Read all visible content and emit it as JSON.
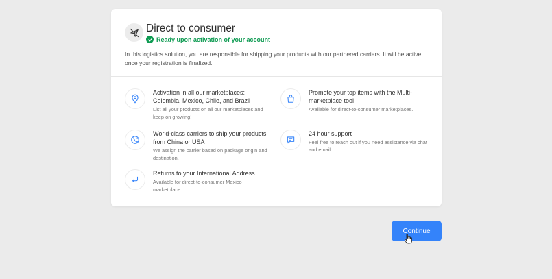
{
  "card": {
    "title": "Direct to consumer",
    "status_text": "Ready upon activation of your account",
    "description": "In this logistics solution, you are responsible for shipping your products with our partnered carriers. It will be active once your registration is finalized."
  },
  "features": [
    {
      "icon": "location-pin-icon",
      "title": "Activation in all our marketplaces: Colombia, Mexico, Chile, and Brazil",
      "subtitle": "List all your products on all our marketplaces and keep on growing!"
    },
    {
      "icon": "shopping-bag-icon",
      "title": "Promote your top items with the Multi-marketplace tool",
      "subtitle": "Available for direct-to-consumer marketplaces."
    },
    {
      "icon": "globe-icon",
      "title": "World-class carriers to ship your products from China or USA",
      "subtitle": "We assign the carrier based on package origin and destination."
    },
    {
      "icon": "chat-icon",
      "title": "24 hour support",
      "subtitle": "Feel free to reach out if you need assistance via chat and email."
    },
    {
      "icon": "return-arrow-icon",
      "title": "Returns to your International Address",
      "subtitle": "Available for direct-to-consumer Mexico marketplace"
    }
  ],
  "continue_label": "Continue",
  "colors": {
    "background": "#ebebeb",
    "accent": "#3483fa",
    "success": "#0e9b52",
    "icon_blue": "#3483fa"
  }
}
